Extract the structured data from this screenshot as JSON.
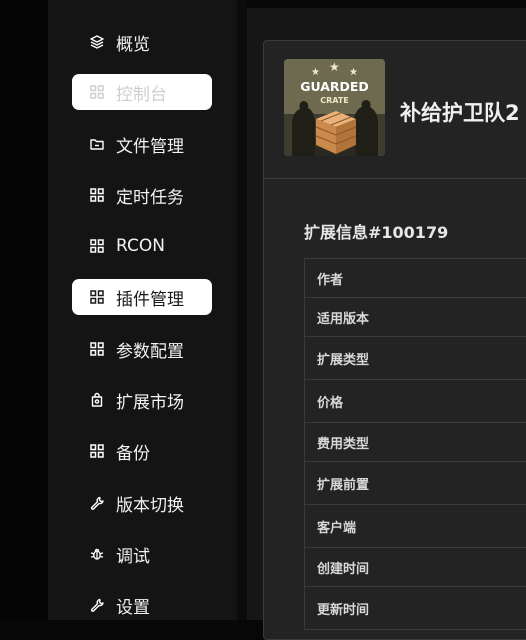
{
  "sidebar": {
    "items": [
      {
        "label": "概览",
        "icon": "layers-icon",
        "state": "normal"
      },
      {
        "label": "控制台",
        "icon": "grid-icon",
        "state": "disabled"
      },
      {
        "label": "文件管理",
        "icon": "folder-icon",
        "state": "normal"
      },
      {
        "label": "定时任务",
        "icon": "grid-icon",
        "state": "normal"
      },
      {
        "label": "RCON",
        "icon": "grid-icon",
        "state": "normal"
      },
      {
        "label": "插件管理",
        "icon": "grid-icon",
        "state": "active"
      },
      {
        "label": "参数配置",
        "icon": "grid-icon",
        "state": "normal"
      },
      {
        "label": "扩展市场",
        "icon": "bag-icon",
        "state": "normal"
      },
      {
        "label": "备份",
        "icon": "grid-icon",
        "state": "normal"
      },
      {
        "label": "版本切换",
        "icon": "wrench-icon",
        "state": "normal"
      },
      {
        "label": "调试",
        "icon": "bug-icon",
        "state": "normal"
      },
      {
        "label": "设置",
        "icon": "wrench-icon",
        "state": "normal"
      }
    ]
  },
  "extension": {
    "title": "补给护卫队2",
    "logo_text_top": "GUARDED",
    "logo_text_bottom": "CRATE",
    "info_title": "扩展信息#100179",
    "fields": [
      "作者",
      "适用版本",
      "扩展类型",
      "价格",
      "费用类型",
      "扩展前置",
      "客户端",
      "创建时间",
      "更新时间"
    ]
  },
  "colors": {
    "active_bg": "#ffffff",
    "sidebar_bg": "#141414",
    "card_bg": "#232323"
  }
}
